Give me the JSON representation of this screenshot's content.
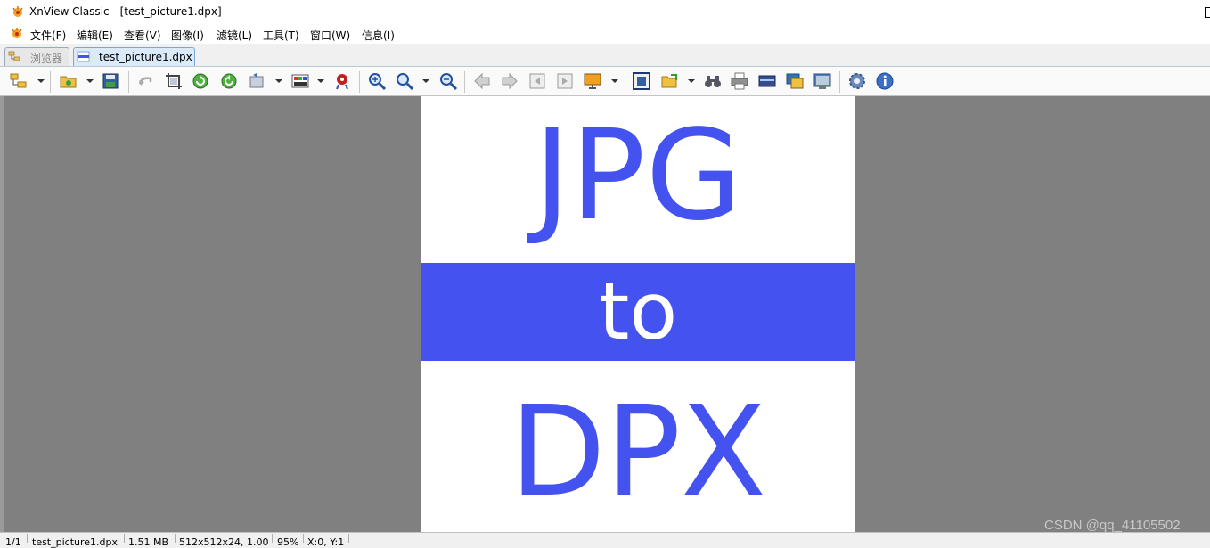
{
  "window": {
    "title": "XnView Classic - [test_picture1.dpx]"
  },
  "menu": [
    "文件(F)",
    "编辑(E)",
    "查看(V)",
    "图像(I)",
    "滤镜(L)",
    "工具(T)",
    "窗口(W)",
    "信息(I)"
  ],
  "tabs": [
    {
      "label": "浏览器",
      "active": false
    },
    {
      "label": "test_picture1.dpx",
      "active": true
    }
  ],
  "toolbar_icons": [
    "folder-tree-icon",
    "open-folder-icon",
    "save-icon",
    "undo-icon",
    "crop-icon",
    "rotate-left-icon",
    "rotate-right-icon",
    "transform-icon",
    "adjust-colors-icon",
    "remove-red-eye-icon",
    "zoom-in-icon",
    "zoom-icon",
    "zoom-out-icon",
    "previous-icon",
    "next-icon",
    "first-page-icon",
    "last-page-icon",
    "slideshow-icon",
    "fullscreen-icon",
    "export-icon",
    "find-icon",
    "print-icon",
    "scan-icon",
    "capture-icon",
    "wallpaper-icon",
    "settings-icon",
    "info-icon"
  ],
  "image": {
    "line1": "JPG",
    "line2": "to",
    "line3": "DPX",
    "text_color": "#4453f0",
    "band_color": "#4453f0"
  },
  "status": {
    "index": "1/1",
    "filename": "test_picture1.dpx",
    "size": "1.51 MB",
    "dimensions": "512x512x24, 1.00",
    "zoom": "95%",
    "coords": "X:0, Y:1"
  },
  "watermark": "CSDN @qq_41105502"
}
